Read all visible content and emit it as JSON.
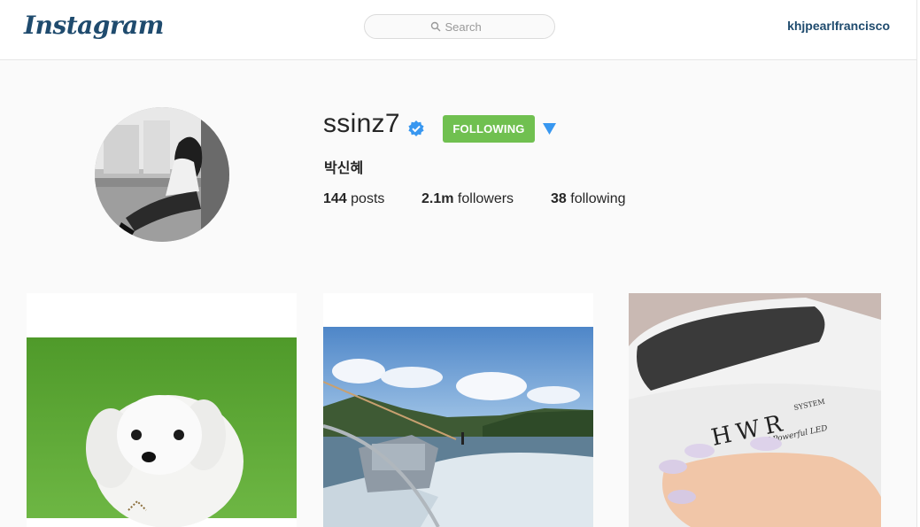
{
  "header": {
    "logo": "Instagram",
    "search_placeholder": "Search",
    "current_user": "khjpearlfrancisco"
  },
  "profile": {
    "username": "ssinz7",
    "verified": true,
    "follow_button": "FOLLOWING",
    "full_name": "박신혜",
    "stats": {
      "posts_count": "144",
      "posts_label": "posts",
      "followers_count": "2.1m",
      "followers_label": "followers",
      "following_count": "38",
      "following_label": "following"
    }
  },
  "colors": {
    "following_green": "#70c050",
    "verified_blue": "#3897f0",
    "link_blue": "#1f4b6e"
  },
  "posts": [
    {
      "subject": "white-dog-on-grass"
    },
    {
      "subject": "speedboat-wake-on-lake"
    },
    {
      "subject": "hand-on-uv-nail-lamp"
    }
  ],
  "lamp_text": {
    "brand": "HWR",
    "system": "SYSTEM",
    "led": "W Powerful LED"
  }
}
